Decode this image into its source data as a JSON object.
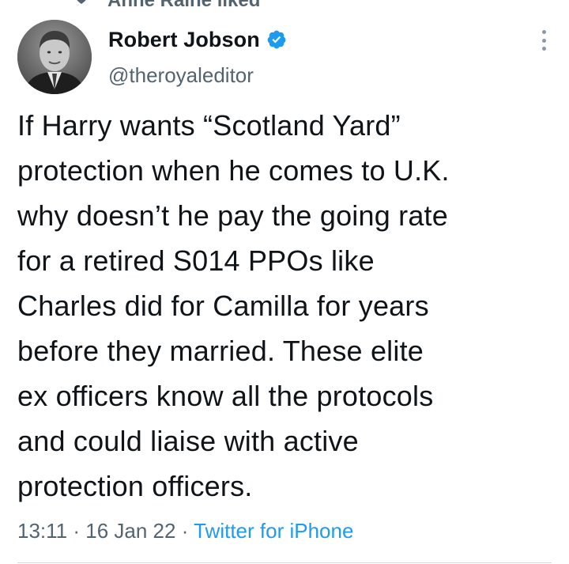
{
  "social_context": {
    "text": "Anne Raine liked",
    "icon": "heart-icon"
  },
  "author": {
    "name": "Robert Jobson",
    "handle": "@theroyaleditor",
    "verified": true,
    "verified_icon": "verified-badge-icon",
    "avatar": "profile-photo"
  },
  "menu": {
    "icon": "more-options-icon"
  },
  "tweet": {
    "text": "If Harry wants “Scotland Yard”\nprotection when he comes to U.K.\nwhy doesn’t he pay the going rate\nfor a retired S014 PPOs like\nCharles did for Camilla for years\nbefore they married. These elite\nex officers know all the protocols\nand could liaise with active\nprotection officers."
  },
  "meta": {
    "time": "13:11",
    "separator": " · ",
    "date": "16 Jan 22",
    "source": "Twitter for iPhone"
  },
  "colors": {
    "text": "#0f1419",
    "secondary": "#536471",
    "accent": "#1d9bf0"
  }
}
